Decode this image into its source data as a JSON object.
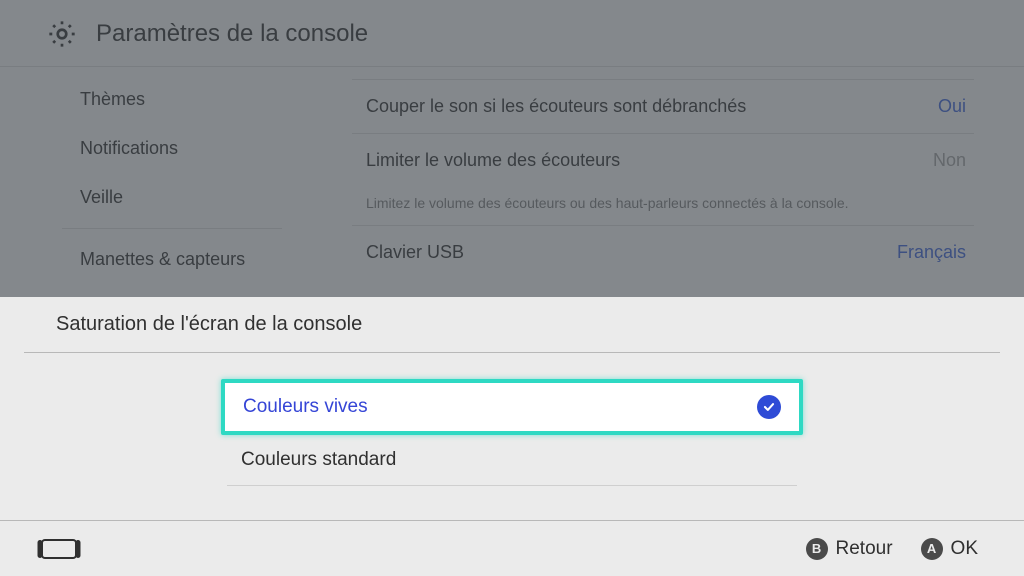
{
  "header": {
    "title": "Paramètres de la console"
  },
  "sidebar": {
    "items": [
      {
        "label": "Thèmes"
      },
      {
        "label": "Notifications"
      },
      {
        "label": "Veille"
      },
      {
        "label": "Manettes & capteurs"
      }
    ]
  },
  "main": {
    "rows": [
      {
        "label": "Couper le son si les écouteurs sont débranchés",
        "value": "Oui",
        "value_kind": "blue"
      },
      {
        "label": "Limiter le volume des écouteurs",
        "value": "Non",
        "value_kind": "gray"
      }
    ],
    "help": "Limitez le volume des écouteurs ou des haut-parleurs connectés à la console.",
    "rows2": [
      {
        "label": "Clavier USB",
        "value": "Français",
        "value_kind": "blue"
      }
    ]
  },
  "modal": {
    "title": "Saturation de l'écran de la console",
    "options": [
      {
        "label": "Couleurs vives",
        "selected": true
      },
      {
        "label": "Couleurs standard",
        "selected": false
      }
    ]
  },
  "footer": {
    "hints": [
      {
        "button": "B",
        "label": "Retour"
      },
      {
        "button": "A",
        "label": "OK"
      }
    ]
  },
  "icons": {
    "gear": "gear-icon",
    "controller": "controller-icon",
    "check": "check-icon"
  }
}
